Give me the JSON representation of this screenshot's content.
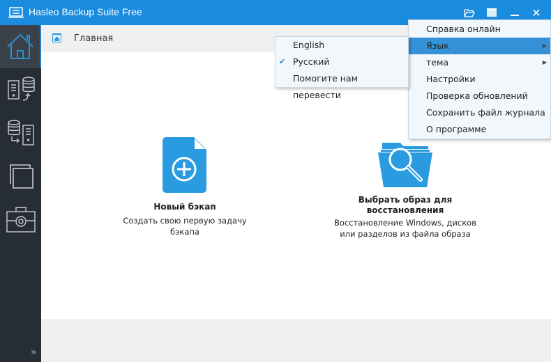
{
  "window": {
    "title": "Hasleo Backup Suite Free"
  },
  "titlebar_buttons": [
    "open-folder-icon",
    "menu-icon",
    "minimize-icon",
    "close-icon"
  ],
  "sidebar": {
    "items": [
      {
        "name": "home",
        "icon": "home-icon",
        "active": true
      },
      {
        "name": "backup",
        "icon": "backup-icon"
      },
      {
        "name": "restore",
        "icon": "restore-icon"
      },
      {
        "name": "clone",
        "icon": "clone-icon"
      },
      {
        "name": "tools",
        "icon": "toolbox-icon"
      }
    ]
  },
  "breadcrumb": {
    "label": "Главная"
  },
  "cards": [
    {
      "title": "Новый бэкап",
      "desc_lines": [
        "Создать свою первую задачу",
        "бэкапа"
      ]
    },
    {
      "title_lines": [
        "Выбрать образ для",
        "восстановления"
      ],
      "desc_lines": [
        "Восстановление Windows, дисков",
        "или разделов из файла образа"
      ]
    }
  ],
  "main_menu": {
    "items": [
      "Справка онлайн",
      "Язык",
      "тема",
      "Настройки",
      "Проверка обновлений",
      "Сохранить файл журнала",
      "О программе"
    ],
    "highlighted": "Язык"
  },
  "language_menu": {
    "items": [
      "English",
      "Русский",
      "Помогите нам перевести"
    ],
    "checked": "Русский"
  },
  "colors": {
    "accent": "#1a8ce0",
    "sidebar": "#262d34",
    "icon_blue": "#2a9be0"
  }
}
